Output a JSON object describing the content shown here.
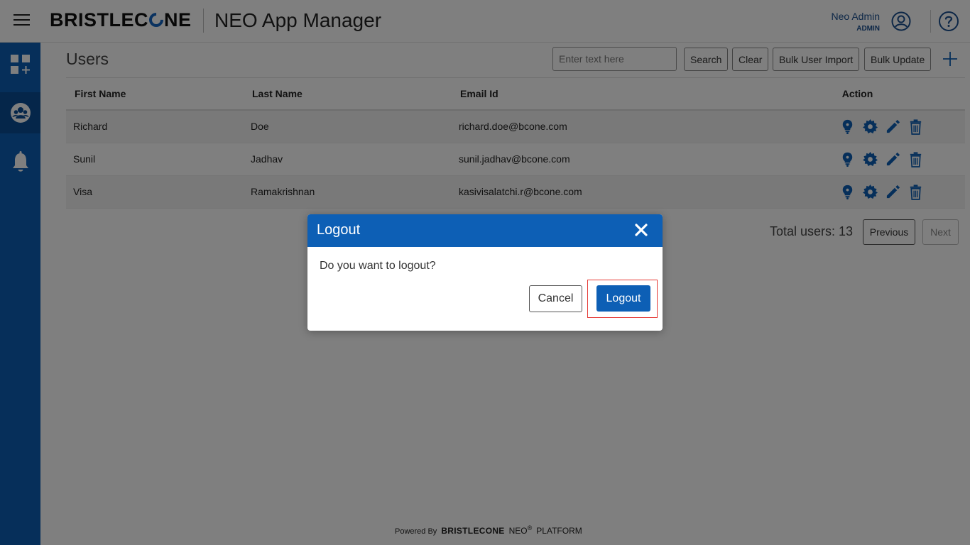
{
  "header": {
    "brand_prefix": "BRISTLEC",
    "brand_suffix": "NE",
    "app_title": "NEO App Manager",
    "user_name": "Neo Admin",
    "user_role": "ADMIN"
  },
  "sidebar": {
    "items": [
      {
        "icon": "dashboard-add-icon"
      },
      {
        "icon": "users-icon",
        "active": true
      },
      {
        "icon": "notification-bell-icon"
      }
    ]
  },
  "main": {
    "title": "Users",
    "search_placeholder": "Enter text here",
    "search_button": "Search",
    "clear_button": "Clear",
    "bulk_import_button": "Bulk User Import",
    "bulk_update_button": "Bulk Update",
    "columns": [
      "First Name",
      "Last Name",
      "Email Id",
      "Action"
    ],
    "rows": [
      {
        "first": "Richard",
        "last": "Doe",
        "email": "richard.doe@bcone.com"
      },
      {
        "first": "Sunil",
        "last": "Jadhav",
        "email": "sunil.jadhav@bcone.com"
      },
      {
        "first": "Visa",
        "last": "Ramakrishnan",
        "email": "kasivisalatchi.r@bcone.com"
      }
    ],
    "total_users": "Total users: 13",
    "previous_button": "Previous",
    "next_button": "Next"
  },
  "footer": {
    "powered_by": "Powered By",
    "brand": "BRISTLECONE",
    "neo": "NEO",
    "reg": "®",
    "platform": "PLATFORM"
  },
  "modal": {
    "title": "Logout",
    "message": "Do you want to logout?",
    "cancel_button": "Cancel",
    "confirm_button": "Logout"
  },
  "colors": {
    "primary": "#0d5fb5",
    "overlay": "rgba(0,0,0,0.5)",
    "focus_outline": "#e53935"
  }
}
